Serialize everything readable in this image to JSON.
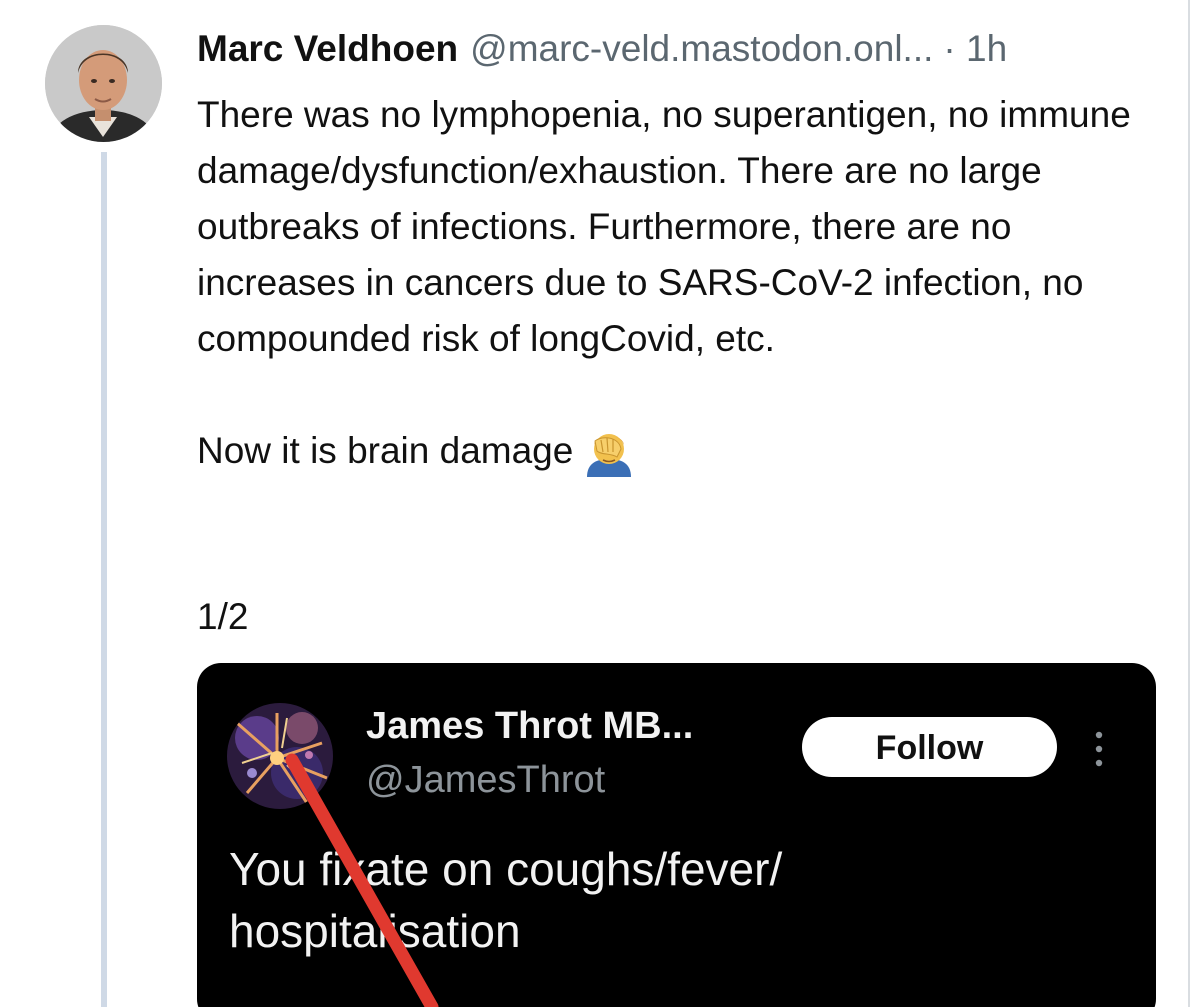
{
  "post": {
    "author_name": "Marc Veldhoen",
    "author_handle": "@marc-veld.mastodon.onl...",
    "timestamp": "· 1h",
    "paragraph1": "There was no lymphopenia, no superantigen, no immune damage/dysfunction/exhaustion. There are no large outbreaks of infections. Furthermore, there are no increases in cancers due to SARS-CoV-2 infection, no compounded risk of longCovid, etc.",
    "paragraph2": "Now it is brain damage",
    "emoji_icon": "facepalm-emoji",
    "thread_counter": "1/2"
  },
  "embed": {
    "author_name": "James Throt MB...",
    "author_handle": "@JamesThrot",
    "follow_label": "Follow",
    "text_line1": "You fixate on coughs/fever/",
    "text_line2": "hospitalisation",
    "annotation_arrow_color": "#e0392f"
  },
  "colors": {
    "thread_line": "#cfd9e6",
    "handle_gray": "#5b6770",
    "embed_background": "#000000"
  }
}
